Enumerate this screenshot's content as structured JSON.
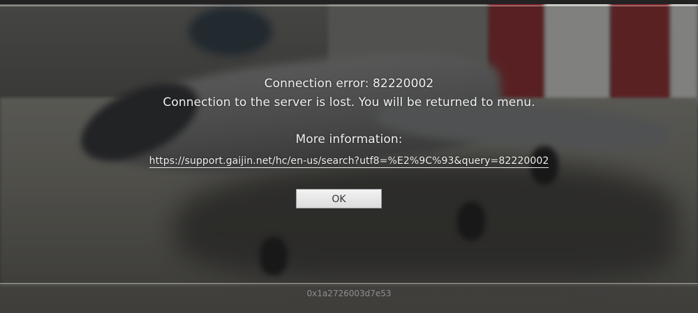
{
  "dialog": {
    "title": "Connection error: 82220002",
    "message": "Connection to the server is lost. You will be returned to menu.",
    "more_info_label": "More information:",
    "link_text": "https://support.gaijin.net/hc/en-us/search?utf8=%E2%9C%93&query=82220002",
    "ok_label": "OK"
  },
  "footer": {
    "session_id": "0x1a2726003d7e53"
  },
  "colors": {
    "text": "#f2f2f2",
    "button_bg": "#e6e6e6",
    "button_text": "#333333",
    "hangar_red": "#8a2a2e"
  }
}
